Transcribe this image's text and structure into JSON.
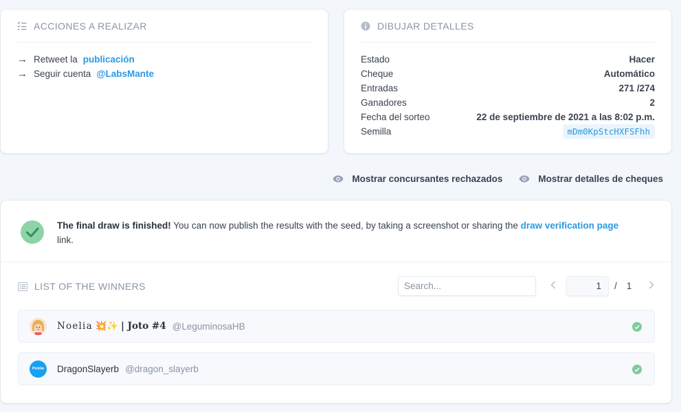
{
  "actions": {
    "title": "ACCIONES A REALIZAR",
    "items": [
      {
        "prefix": "Retweet la",
        "link": "publicación"
      },
      {
        "prefix": "Seguir cuenta",
        "link": "@LabsMante"
      }
    ]
  },
  "details": {
    "title": "DIBUJAR DETALLES",
    "rows": [
      {
        "label": "Estado",
        "value": "Hacer"
      },
      {
        "label": "Cheque",
        "value": "Automático"
      },
      {
        "label": "Entradas",
        "value": "271 /274"
      },
      {
        "label": "Ganadores",
        "value": "2"
      },
      {
        "label": "Fecha del sorteo",
        "value": "22 de septiembre de 2021 a las 8:02 p.m."
      },
      {
        "label": "Semilla",
        "value": "mDm0KpStcHXFSFhh"
      }
    ]
  },
  "toggles": {
    "rejected": "Mostrar concursantes rechazados",
    "checks": "Mostrar detalles de cheques"
  },
  "notice": {
    "bold": "The final draw is finished!",
    "text": " You can now publish the results with the seed, by taking a screenshot or sharing the ",
    "link": "draw verification page",
    "tail": "link."
  },
  "winners": {
    "title": "LIST OF THE WINNERS",
    "search_placeholder": "Search...",
    "page_current": "1",
    "page_separator": "/",
    "page_total": "1",
    "list": [
      {
        "name": "Noelia",
        "emoji": "💥✨",
        "extra": "| Joto #4",
        "handle": "@LeguminosaHB"
      },
      {
        "name": "DragonSlayerb",
        "emoji": "",
        "extra": "",
        "handle": "@dragon_slayerb",
        "avatar_text": "Pickliw"
      }
    ]
  },
  "colors": {
    "accent": "#2b9ae0",
    "success": "#7ecb9b",
    "muted": "#8a94a6",
    "background": "#f3f7fc"
  }
}
